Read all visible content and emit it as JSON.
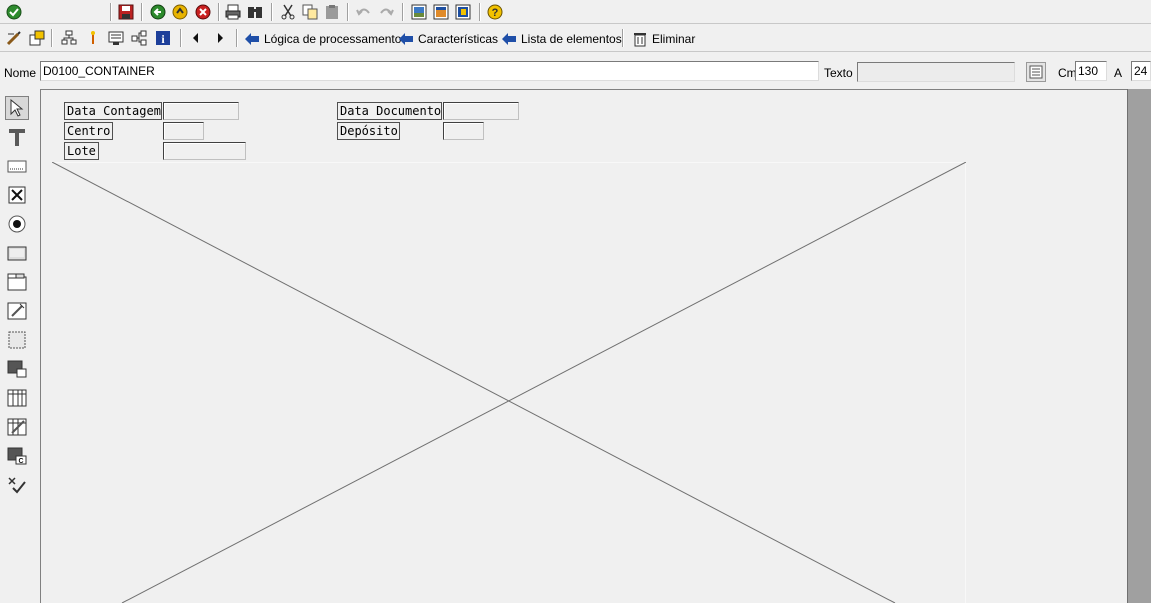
{
  "toolbar1": {
    "icons": [
      "check-icon",
      "save-icon",
      "back-icon",
      "exit-icon",
      "cancel-icon",
      "print-icon",
      "find-icon",
      "cut-icon",
      "copy-icon",
      "paste-icon",
      "undo-icon",
      "redo-icon",
      "layout-icon",
      "layout2-icon",
      "layout3-icon",
      "help-icon"
    ]
  },
  "toolbar2": {
    "logic_label": "Lógica de processamento",
    "chars_label": "Características",
    "elements_label": "Lista de elementos",
    "delete_label": "Eliminar"
  },
  "attrs": {
    "name_label": "Nome",
    "name_value": "D0100_CONTAINER",
    "text_label": "Texto",
    "text_value": "",
    "cm_label": "Cm",
    "cm_value": "130",
    "a_label": "A",
    "a_value": "24"
  },
  "screen": {
    "lbl_data_contagem": "Data Contagem",
    "lbl_centro": "Centro",
    "lbl_lote": "Lote",
    "lbl_data_documento": "Data Documento",
    "lbl_deposito": "Depósito"
  },
  "colors": {
    "background": "#f0f0f0",
    "right_panel": "#a0a0a0",
    "arrow_blue": "#1f4fa8"
  }
}
